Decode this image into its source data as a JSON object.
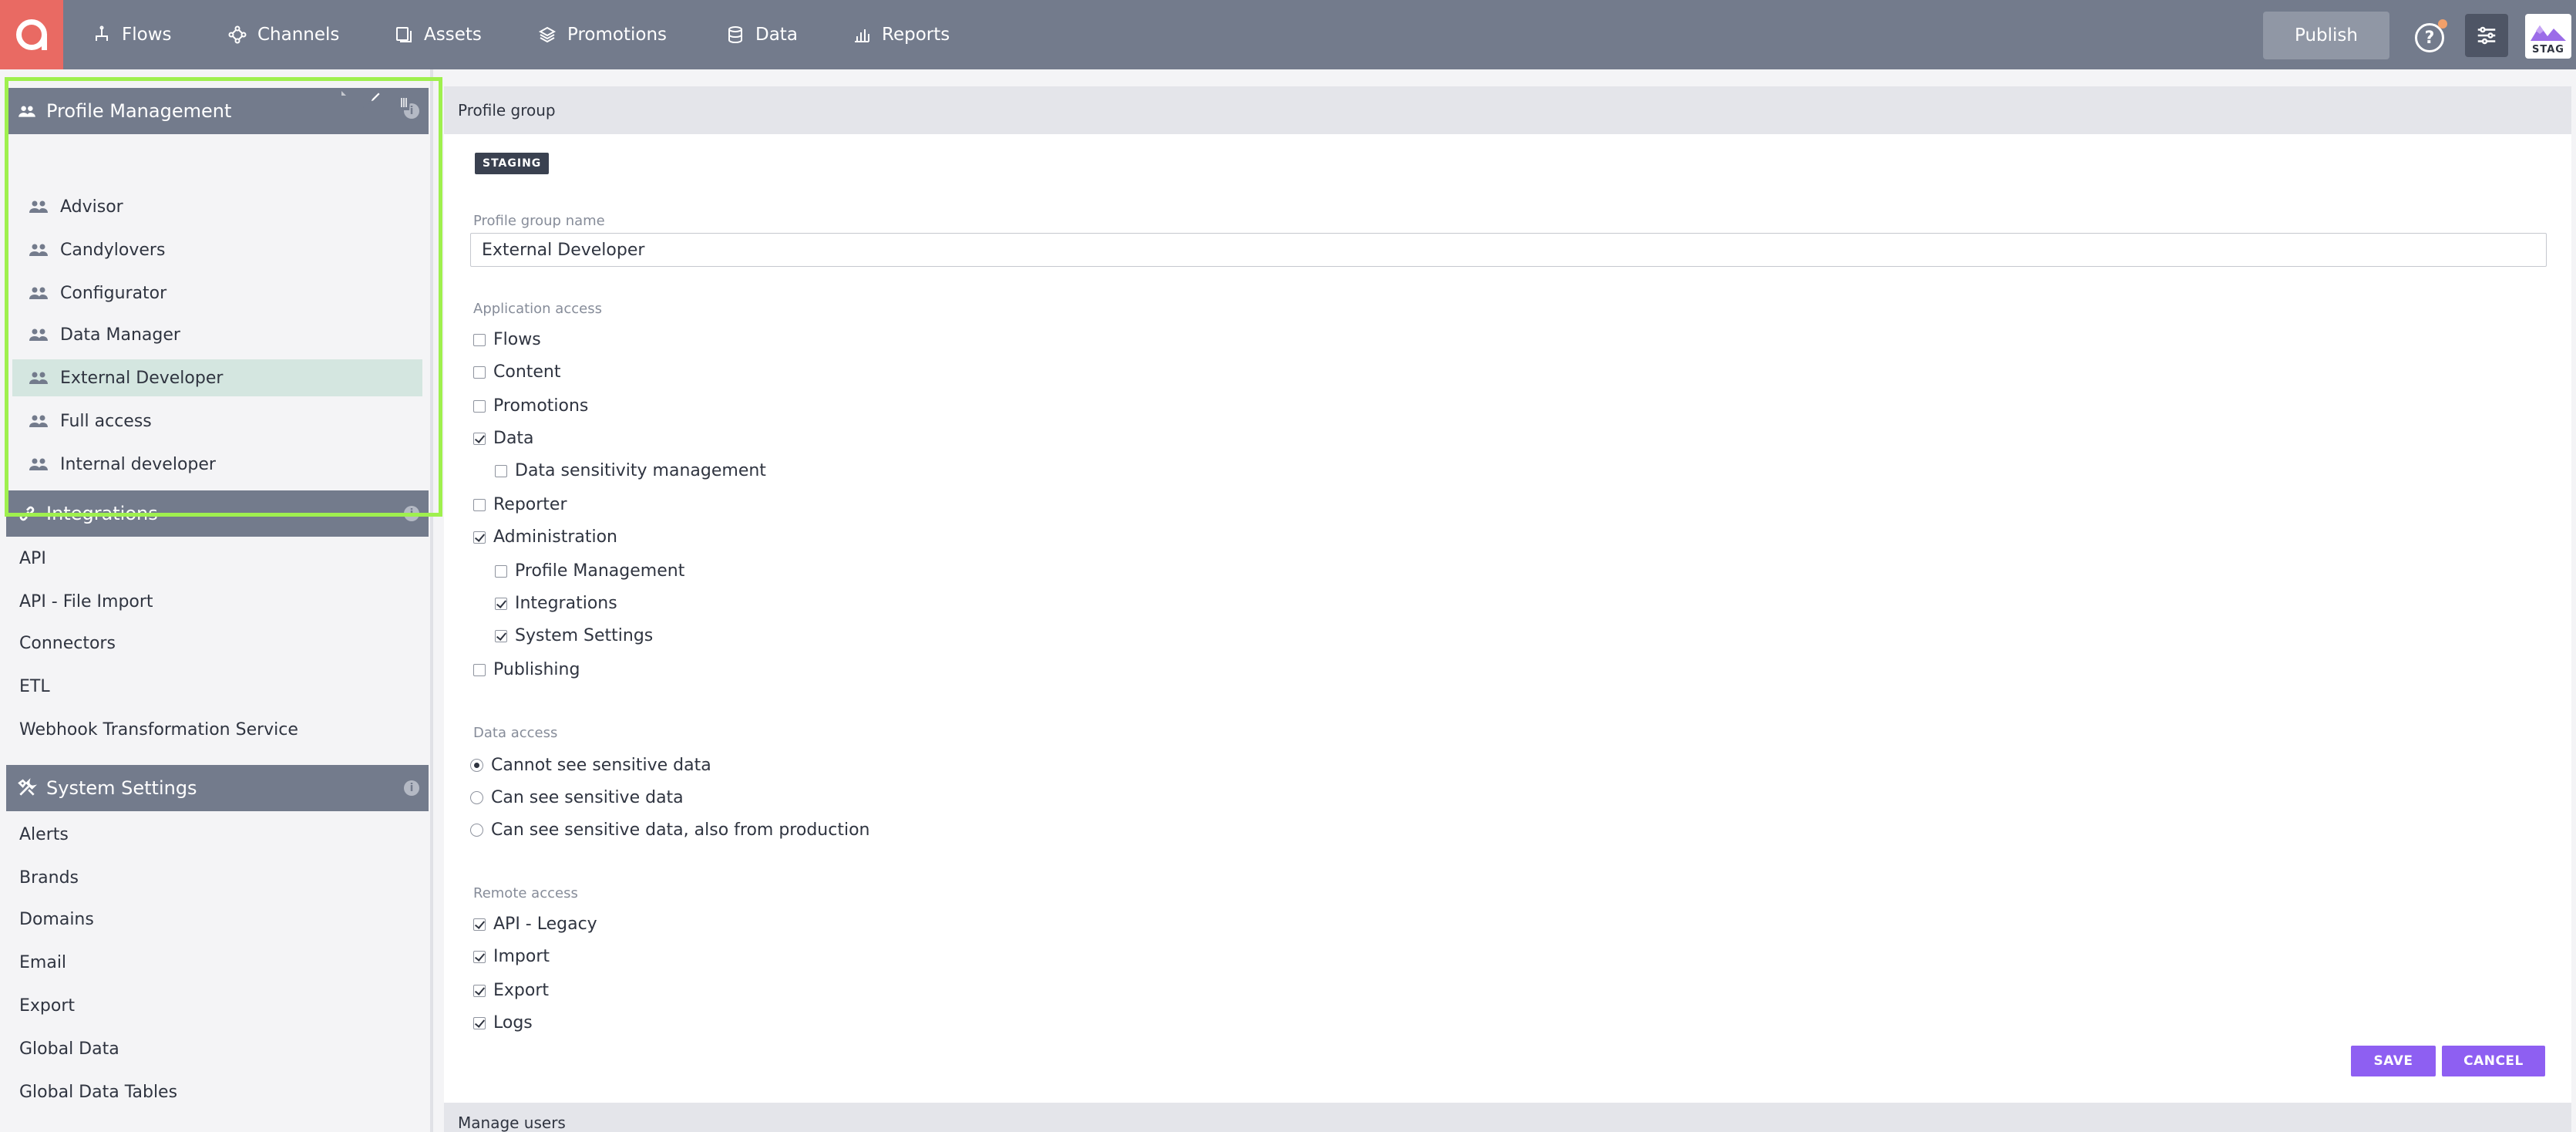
{
  "nav": {
    "items": [
      {
        "label": "Flows",
        "icon": "flows-icon"
      },
      {
        "label": "Channels",
        "icon": "channels-icon"
      },
      {
        "label": "Assets",
        "icon": "assets-icon"
      },
      {
        "label": "Promotions",
        "icon": "promotions-icon"
      },
      {
        "label": "Data",
        "icon": "data-icon"
      },
      {
        "label": "Reports",
        "icon": "reports-icon"
      }
    ],
    "publish_label": "Publish",
    "help_glyph": "?",
    "env_label": "STAG",
    "colors": {
      "bar": "#737b8c",
      "logo": "#e96a63",
      "accent": "#8e5ff2",
      "selected": "#d4e6e0",
      "highlight": "#9ff04e"
    }
  },
  "sidebar": {
    "profile_management": {
      "title": "Profile Management",
      "info_glyph": "i",
      "groups": [
        "Advisor",
        "Candylovers",
        "Configurator",
        "Data Manager",
        "External Developer",
        "Full access",
        "Internal developer"
      ],
      "selected": "External Developer"
    },
    "integrations": {
      "title": "Integrations",
      "info_glyph": "i",
      "items": [
        "API",
        "API - File Import",
        "Connectors",
        "ETL",
        "Webhook Transformation Service"
      ]
    },
    "system_settings": {
      "title": "System Settings",
      "info_glyph": "i",
      "items": [
        "Alerts",
        "Brands",
        "Domains",
        "Email",
        "Export",
        "Global Data",
        "Global Data Tables"
      ]
    }
  },
  "main": {
    "header": "Profile group",
    "badge": "STAGING",
    "name_label": "Profile group name",
    "name_value": "External Developer",
    "app_access_label": "Application access",
    "app_access": [
      {
        "label": "Flows",
        "checked": false
      },
      {
        "label": "Content",
        "checked": false
      },
      {
        "label": "Promotions",
        "checked": false
      },
      {
        "label": "Data",
        "checked": true
      },
      {
        "label": "Data sensitivity management",
        "checked": false
      },
      {
        "label": "Reporter",
        "checked": false
      },
      {
        "label": "Administration",
        "checked": true
      },
      {
        "label": "Profile Management",
        "checked": false
      },
      {
        "label": "Integrations",
        "checked": true
      },
      {
        "label": "System Settings",
        "checked": true
      },
      {
        "label": "Publishing",
        "checked": false
      }
    ],
    "data_access_label": "Data access",
    "data_access": [
      {
        "label": "Cannot see sensitive data",
        "checked": true
      },
      {
        "label": "Can see sensitive data",
        "checked": false
      },
      {
        "label": "Can see sensitive data, also from production",
        "checked": false
      }
    ],
    "remote_access_label": "Remote access",
    "remote_access": [
      {
        "label": "API - Legacy",
        "checked": true
      },
      {
        "label": "Import",
        "checked": true
      },
      {
        "label": "Export",
        "checked": true
      },
      {
        "label": "Logs",
        "checked": true
      }
    ],
    "save_label": "SAVE",
    "cancel_label": "CANCEL",
    "manage_users_label": "Manage users"
  }
}
